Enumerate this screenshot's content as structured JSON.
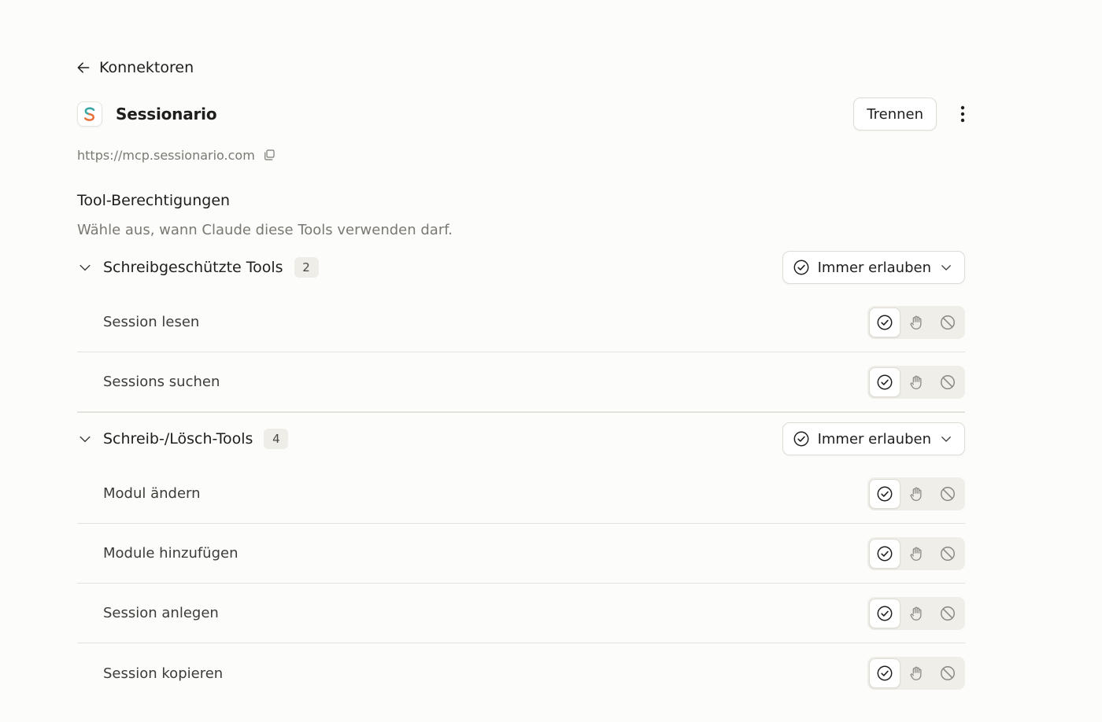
{
  "nav": {
    "back_label": "Konnektoren"
  },
  "connector": {
    "name": "Sessionario",
    "logo_letter": "S",
    "url": "https://mcp.sessionario.com",
    "disconnect_label": "Trennen"
  },
  "permissions": {
    "title": "Tool-Berechtigungen",
    "subtitle": "Wähle aus, wann Claude diese Tools verwenden darf.",
    "groups": [
      {
        "name": "Schreibgeschützte Tools",
        "count": "2",
        "setting": "Immer erlauben",
        "tools": [
          {
            "name": "Session lesen",
            "state": "allow"
          },
          {
            "name": "Sessions suchen",
            "state": "allow"
          }
        ]
      },
      {
        "name": "Schreib-/Lösch-Tools",
        "count": "4",
        "setting": "Immer erlauben",
        "tools": [
          {
            "name": "Modul ändern",
            "state": "allow"
          },
          {
            "name": "Module hinzufügen",
            "state": "allow"
          },
          {
            "name": "Session anlegen",
            "state": "allow"
          },
          {
            "name": "Session kopieren",
            "state": "allow"
          }
        ]
      }
    ]
  },
  "icons": {
    "back": "arrow-left-icon",
    "copy": "copy-icon",
    "more": "more-vertical-icon",
    "collapse": "chevron-down-icon",
    "allow": "check-circle-icon",
    "ask": "hand-icon",
    "block": "ban-icon"
  },
  "colors": {
    "background": "#fcfcfa",
    "logo_teal": "#3aa7a3",
    "logo_orange": "#e8703a",
    "muted_text": "#7a7872"
  }
}
